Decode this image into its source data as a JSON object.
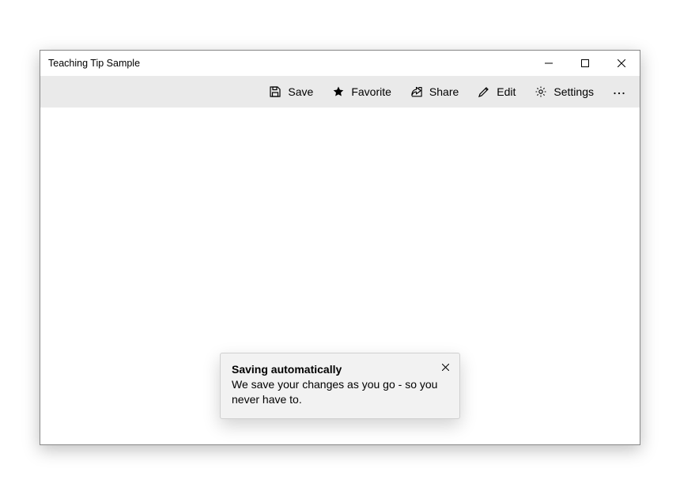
{
  "window": {
    "title": "Teaching Tip Sample"
  },
  "commandbar": {
    "save": "Save",
    "favorite": "Favorite",
    "share": "Share",
    "edit": "Edit",
    "settings": "Settings"
  },
  "teaching_tip": {
    "title": "Saving automatically",
    "subtitle": "We save your changes as you go - so you never have to."
  }
}
